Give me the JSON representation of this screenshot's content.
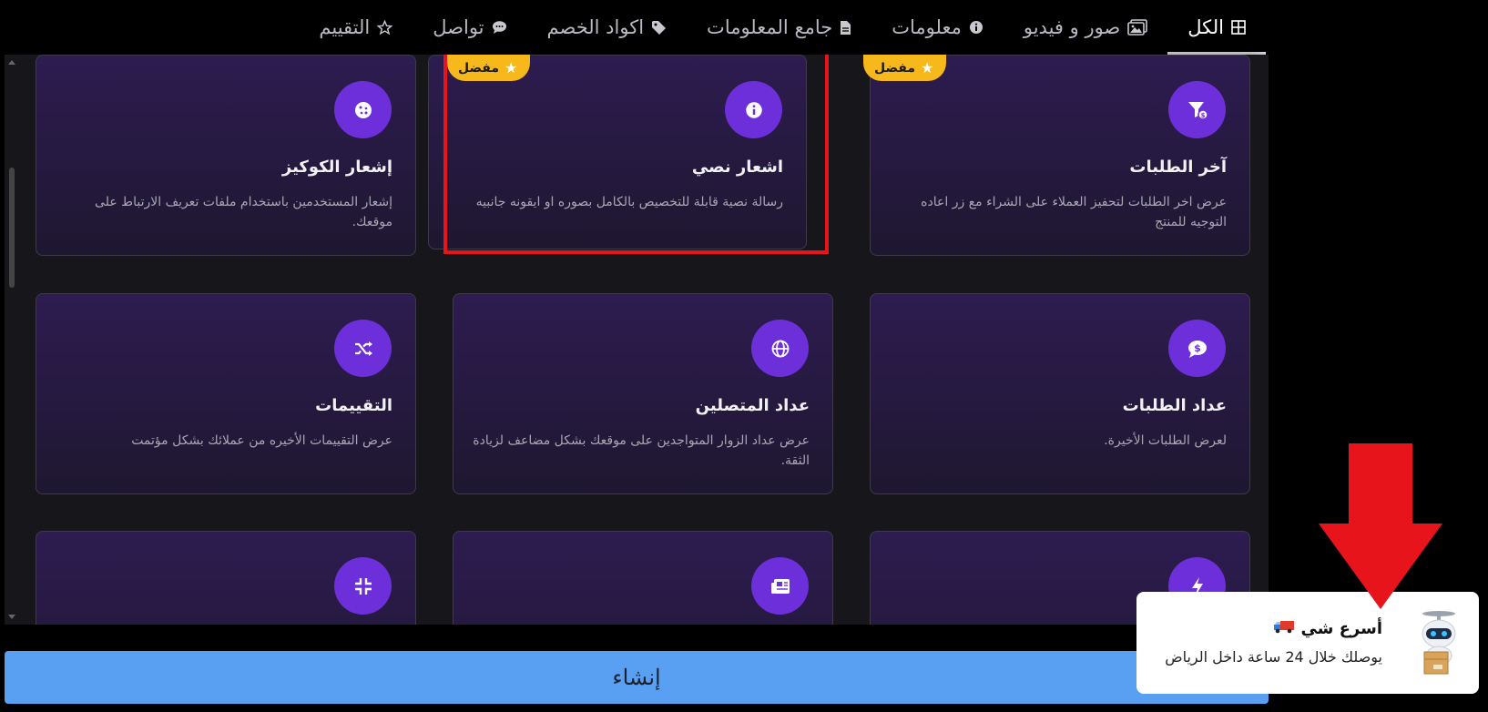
{
  "tabs": [
    {
      "label": "الكل",
      "icon": "grid-icon",
      "active": true
    },
    {
      "label": "صور و فيديو",
      "icon": "images-icon"
    },
    {
      "label": "معلومات",
      "icon": "info-icon"
    },
    {
      "label": "جامع المعلومات",
      "icon": "file-icon"
    },
    {
      "label": "اكواد الخصم",
      "icon": "tag-icon"
    },
    {
      "label": "تواصل",
      "icon": "chat-icon"
    },
    {
      "label": "التقييم",
      "icon": "star-icon"
    }
  ],
  "badge_label": "مفضل",
  "cards": [
    {
      "title": "آخر الطلبات",
      "desc": "عرض اخر الطلبات لتحفيز العملاء على الشراء مع زر اعاده التوجيه للمنتج",
      "icon": "filter-dollar-icon",
      "badge": true
    },
    {
      "title": "اشعار نصي",
      "desc": "رسالة نصية قابلة للتخصيص بالكامل بصوره او ايقونه جانبيه",
      "icon": "info-icon",
      "badge": true
    },
    {
      "title": "إشعار الكوكيز",
      "desc": "إشعار المستخدمين باستخدام ملفات تعريف الارتباط على موقعك.",
      "icon": "cookie-icon",
      "badge": false
    },
    {
      "title": "عداد الطلبات",
      "desc": "لعرض الطلبات الأخيرة.",
      "icon": "dollar-chat-icon",
      "badge": false
    },
    {
      "title": "عداد المتصلين",
      "desc": "عرض عداد الزوار المتواجدين على موقعك بشكل مضاعف لزيادة الثقة.",
      "icon": "globe-icon",
      "badge": false
    },
    {
      "title": "التقييمات",
      "desc": "عرض التقييمات الأخيره من عملائك بشكل مؤتمت",
      "icon": "shuffle-icon",
      "badge": false
    },
    {
      "title": "",
      "desc": "",
      "icon": "bolt-icon",
      "badge": false
    },
    {
      "title": "",
      "desc": "",
      "icon": "newspaper-icon",
      "badge": false
    },
    {
      "title": "",
      "desc": "",
      "icon": "compress-icon",
      "badge": false
    }
  ],
  "create_button": "إنشاء",
  "toast": {
    "title": "أسرع شي",
    "subtitle": "يوصلك خلال 24 ساعة داخل الرياض",
    "icon": "truck-icon"
  },
  "colors": {
    "accent": "#6d2fd9",
    "badge": "#f6b81a",
    "highlight": "#e8141c",
    "create": "#5aa0f2"
  }
}
